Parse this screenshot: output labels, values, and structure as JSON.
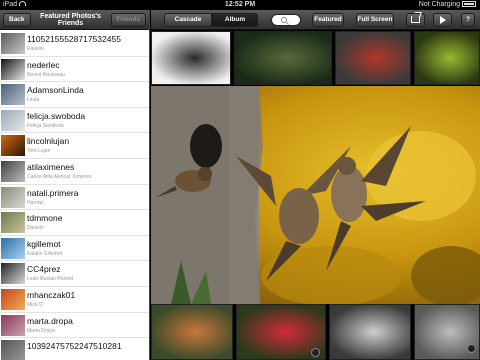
{
  "status": {
    "device": "iPad",
    "time": "12:52 PM",
    "battery": "Not Charging"
  },
  "left": {
    "back_label": "Back",
    "title": "Featured Photos's Friends",
    "friends_label": "Friends",
    "friends": [
      {
        "name": "11052155528717532455",
        "sub": "Ravello",
        "c1": "#5a5a5a",
        "c2": "#c8c8c8"
      },
      {
        "name": "nederlec",
        "sub": "Benoit Rousseau",
        "c1": "#111111",
        "c2": "#e8e8e8"
      },
      {
        "name": "AdamsonLinda",
        "sub": "Linda",
        "c1": "#4b5f78",
        "c2": "#b6c2cc"
      },
      {
        "name": "felicja.swoboda",
        "sub": "Felicja Swoboda",
        "c1": "#9aa8b8",
        "c2": "#e6e6e6"
      },
      {
        "name": "lincolnlujan",
        "sub": "Tere Luján",
        "c1": "#d26a12",
        "c2": "#2a1606"
      },
      {
        "name": "atilaximenes",
        "sub": "Carlos Átila Alencar Ximenes",
        "c1": "#404040",
        "c2": "#bdbdbd"
      },
      {
        "name": "natali.primera",
        "sub": "Harrow",
        "c1": "#8a8a7a",
        "c2": "#d8d8d0"
      },
      {
        "name": "tdmmone",
        "sub": "Daniele",
        "c1": "#6e7c4a",
        "c2": "#c9c3a0"
      },
      {
        "name": "kgillemot",
        "sub": "Katalin Gillemot",
        "c1": "#2c6ea8",
        "c2": "#a9d0ec"
      },
      {
        "name": "CC4prez",
        "sub": "Leah Muelan-Pannel",
        "c1": "#222222",
        "c2": "#d8d8d8"
      },
      {
        "name": "mhanczak01",
        "sub": "Mick72",
        "c1": "#c8421e",
        "c2": "#f0b050"
      },
      {
        "name": "marta.dropa",
        "sub": "Marta Dropa",
        "c1": "#8a3a5a",
        "c2": "#caa0b0"
      },
      {
        "name": "10392475752247510281",
        "sub": "",
        "c1": "#555555",
        "c2": "#999999"
      }
    ]
  },
  "right": {
    "cascade_label": "Cascade",
    "album_label": "Album",
    "featured_label": "Featured",
    "fullscreen_label": "Full Screen",
    "help_label": "?",
    "top_photos": [
      {
        "c1": "#f0f0f0",
        "c2": "#2a2a2a",
        "w": 80
      },
      {
        "c1": "#1b2a18",
        "c2": "#5a6a3a",
        "w": 98
      },
      {
        "c1": "#3a3a3a",
        "c2": "#b0382a",
        "w": 76
      },
      {
        "c1": "#2a3a10",
        "c2": "#9ab832",
        "w": 66
      }
    ],
    "bottom_photos": [
      {
        "c1": "#3a4a2a",
        "c2": "#c8773a",
        "w": 82
      },
      {
        "c1": "#2a3a1a",
        "c2": "#d22a3a",
        "w": 90
      },
      {
        "c1": "#3a3a3a",
        "c2": "#cfcfcf",
        "w": 82
      },
      {
        "c1": "#5a5a5a",
        "c2": "#bdbdbd",
        "w": 66
      }
    ]
  }
}
